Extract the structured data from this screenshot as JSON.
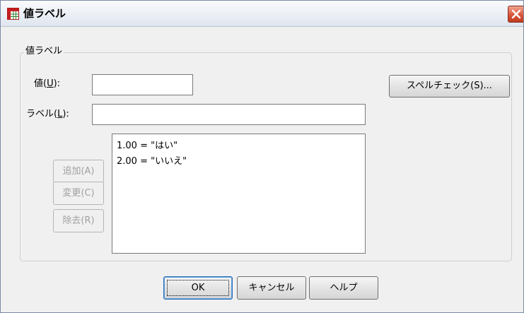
{
  "window": {
    "title": "値ラベル",
    "close_glyph": "✕"
  },
  "group": {
    "legend": "値ラベル"
  },
  "value_field": {
    "label_text": "値(",
    "mnemonic": "U",
    "label_suffix": "):",
    "value": ""
  },
  "label_field": {
    "label_text": "ラベル(",
    "mnemonic": "L",
    "label_suffix": "):",
    "value": ""
  },
  "spell_check_label": "スペルチェック(S)...",
  "list": {
    "items": [
      "1.00 = \"はい\"",
      "2.00 = \"いいえ\""
    ]
  },
  "side_buttons": {
    "add_label": "追加(A)",
    "change_label": "変更(C)",
    "remove_label": "除去(R)"
  },
  "footer": {
    "ok_label": "OK",
    "cancel_label": "キャンセル",
    "help_label": "ヘルプ"
  },
  "colors": {
    "titlebar_bg": "#dfe5ef",
    "window_bg": "#f0f0f0",
    "close_red": "#d9573a",
    "disabled_text": "#a0a0a0",
    "default_border": "#2b6fb3"
  }
}
